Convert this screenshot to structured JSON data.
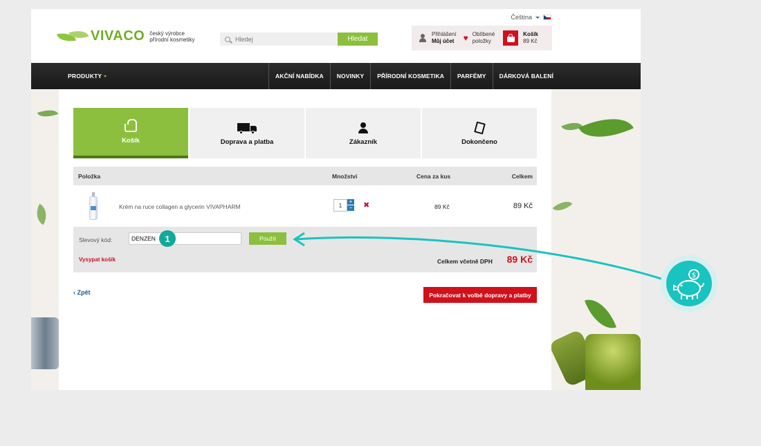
{
  "header": {
    "language": "Čeština",
    "logo_text": "VIVACO",
    "logo_tagline_1": "český výrobce",
    "logo_tagline_2": "přírodní kosmetiky",
    "search_placeholder": "Hledej",
    "search_button": "Hledat",
    "login_label": "Přihlášení",
    "account_label": "Můj účet",
    "favorites_line1": "Oblíbené",
    "favorites_line2": "položky",
    "cart_label": "Košík",
    "cart_total": "89 Kč"
  },
  "nav": {
    "products": "PRODUKTY",
    "items": [
      "AKČNÍ NABÍDKA",
      "NOVINKY",
      "PŘÍRODNÍ KOSMETIKA",
      "PARFÉMY",
      "DÁRKOVÁ BALENÍ"
    ]
  },
  "steps": [
    {
      "label": "Košík",
      "icon": "basket-icon",
      "active": true
    },
    {
      "label": "Doprava a platba",
      "icon": "truck-icon",
      "active": false
    },
    {
      "label": "Zákazník",
      "icon": "person-icon",
      "active": false
    },
    {
      "label": "Dokončeno",
      "icon": "document-icon",
      "active": false
    }
  ],
  "table": {
    "columns": [
      "Položka",
      "Množství",
      "Cena za kus",
      "Celkem"
    ],
    "rows": [
      {
        "name": "Krém na ruce collagen a glycerin VIVAPHARM",
        "quantity": "1",
        "unit_price": "89 Kč",
        "total": "89 Kč"
      }
    ]
  },
  "discount": {
    "label": "Slevový kód:",
    "value": "DENZEN",
    "apply_button": "Použít",
    "empty_cart": "Vysypat košík",
    "total_label": "Celkem včetně DPH",
    "total_value": "89 Kč"
  },
  "footer": {
    "back": "Zpět",
    "continue": "Pokračovat k volbě dopravy a platby"
  },
  "annotation": {
    "badge_number": "1"
  },
  "colors": {
    "brand_green": "#8cbf3d",
    "accent_red": "#d0101b",
    "annotation_teal": "#18c3c0"
  }
}
